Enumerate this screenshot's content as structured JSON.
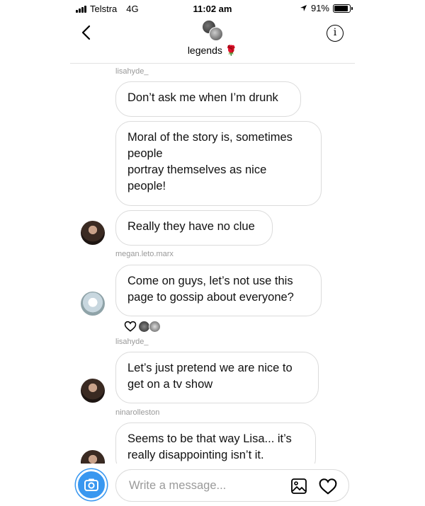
{
  "status_bar": {
    "carrier": "Telstra",
    "network": "4G",
    "time": "11:02 am",
    "battery": "91%",
    "battery_level": 0.91
  },
  "header": {
    "title": "legends 🌹",
    "back_icon": "chevron-left-icon",
    "info_icon": "info-icon",
    "info_glyph": "i"
  },
  "messages": [
    {
      "sender": "lisahyde_",
      "text": "Don’t ask me when I’m drunk"
    },
    {
      "text_line1": "Moral of the story is, sometimes",
      "text_line2": "people",
      "text_line3": "portray themselves as nice",
      "text_line4": "people!"
    },
    {
      "text": "Really they have no clue"
    },
    {
      "sender": "megan.leto.marx",
      "text_line1": "Come on guys, let’s not use this",
      "text_line2": "page to gossip about everyone?"
    },
    {
      "sender": "lisahyde_",
      "text_line1": "Let’s just pretend we are nice to",
      "text_line2": "get on a tv show"
    },
    {
      "sender": "ninarolleston",
      "text_line1": "Seems to be that way Lisa... it’s",
      "text_line2": "really disappointing isn’t it."
    }
  ],
  "composer": {
    "placeholder": "Write a message...",
    "camera_icon": "camera-icon",
    "gallery_icon": "image-icon",
    "like_icon": "heart-icon"
  },
  "colors": {
    "accent": "#3897f0",
    "bubble_border": "#dbdbdb",
    "username": "#999999"
  }
}
